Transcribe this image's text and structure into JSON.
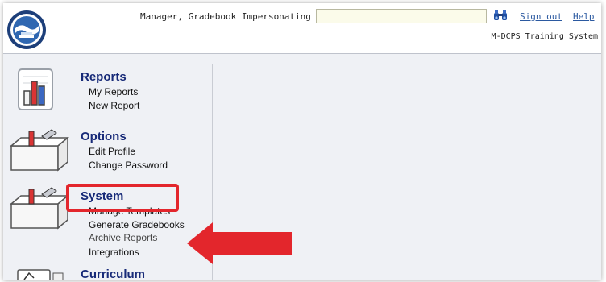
{
  "header": {
    "user_status": "Manager, Gradebook Impersonating",
    "search_value": "",
    "sign_out_label": "Sign out",
    "help_label": "Help",
    "system_name": "M-DCPS Training System"
  },
  "sections": [
    {
      "title": "Reports",
      "icon": "bar-chart-icon",
      "links": [
        "My Reports",
        "New Report"
      ]
    },
    {
      "title": "Options",
      "icon": "toolbox-icon",
      "links": [
        "Edit Profile",
        "Change Password"
      ]
    },
    {
      "title": "System",
      "icon": "toolbox-icon",
      "links": [
        "Manage Templates",
        "Generate Gradebooks",
        "Archive Reports",
        "Integrations"
      ]
    },
    {
      "title": "Curriculum",
      "icon": "notebook-icon",
      "links": []
    }
  ],
  "colors": {
    "section_title": "#172a78",
    "link": "#2b59a0",
    "annotation_red": "#e3262c",
    "background": "#eff1f5"
  },
  "annotation": {
    "highlighted_item": "Integrations",
    "arrow_direction": "left"
  }
}
